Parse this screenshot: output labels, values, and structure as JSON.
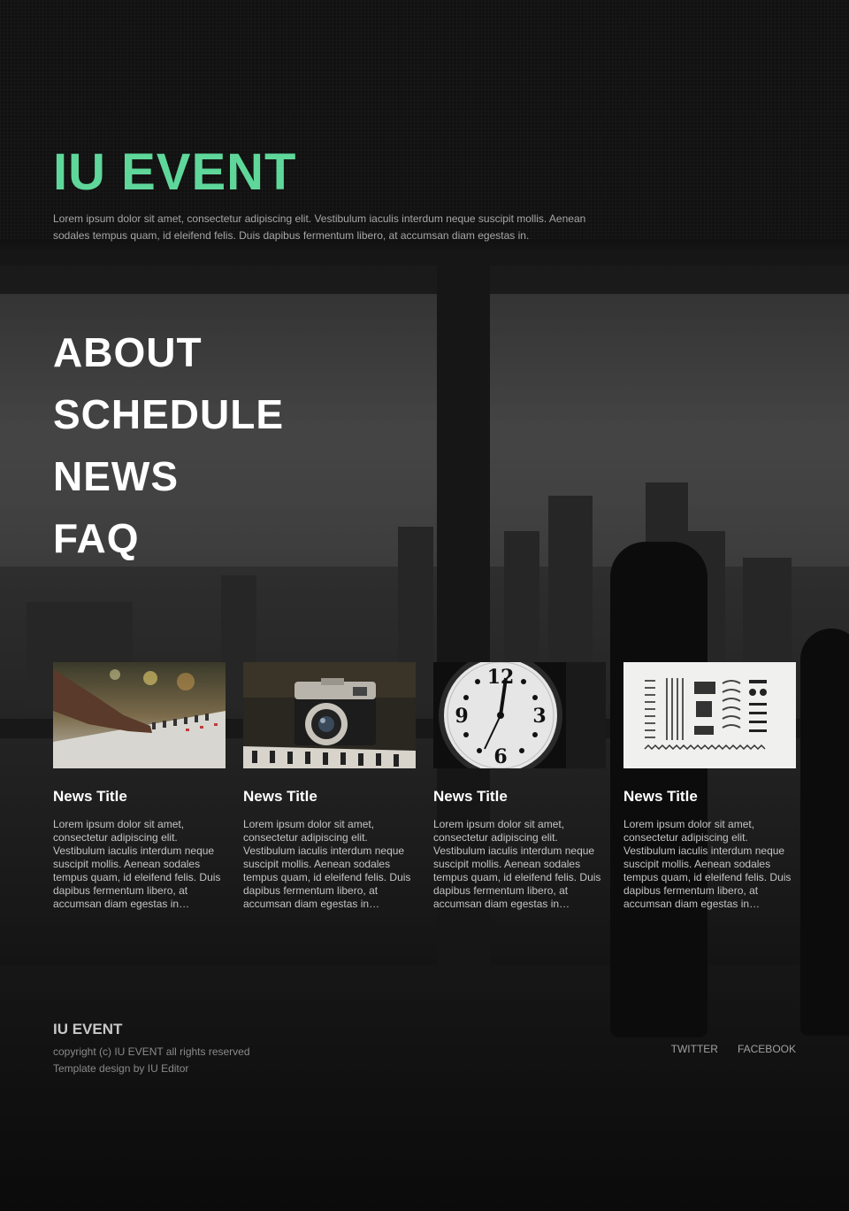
{
  "header": {
    "brand": "IU EVENT",
    "intro": "Lorem ipsum dolor sit amet, consectetur adipiscing elit. Vestibulum iaculis interdum neque suscipit mollis. Aenean sodales tempus quam, id eleifend felis. Duis dapibus fermentum libero, at accumsan diam egestas in."
  },
  "nav": {
    "items": [
      {
        "label": "ABOUT"
      },
      {
        "label": "SCHEDULE"
      },
      {
        "label": "NEWS"
      },
      {
        "label": "FAQ"
      }
    ]
  },
  "news": {
    "items": [
      {
        "title": "News Title",
        "image": "audio-mixer-photo",
        "excerpt": "Lorem ipsum dolor sit amet, consectetur adipiscing elit. Vestibulum iaculis interdum neque suscipit mollis. Aenean sodales tempus quam, id eleifend felis. Duis dapibus fermentum libero, at accumsan diam egestas in…"
      },
      {
        "title": "News Title",
        "image": "vintage-camera-photo",
        "excerpt": "Lorem ipsum dolor sit amet, consectetur adipiscing elit. Vestibulum iaculis interdum neque suscipit mollis. Aenean sodales tempus quam, id eleifend felis. Duis dapibus fermentum libero, at accumsan diam egestas in…"
      },
      {
        "title": "News Title",
        "image": "wall-clock-photo",
        "excerpt": "Lorem ipsum dolor sit amet, consectetur adipiscing elit. Vestibulum iaculis interdum neque suscipit mollis. Aenean sodales tempus quam, id eleifend felis. Duis dapibus fermentum libero, at accumsan diam egestas in…"
      },
      {
        "title": "News Title",
        "image": "typewriter-parts-photo",
        "excerpt": "Lorem ipsum dolor sit amet, consectetur adipiscing elit. Vestibulum iaculis interdum neque suscipit mollis. Aenean sodales tempus quam, id eleifend felis. Duis dapibus fermentum libero, at accumsan diam egestas in…"
      }
    ]
  },
  "footer": {
    "brand": "IU EVENT",
    "copyright": "copyright (c) IU EVENT all rights reserved",
    "credit": "Template design by IU Editor",
    "social": [
      {
        "label": "TWITTER"
      },
      {
        "label": "FACEBOOK"
      }
    ]
  },
  "colors": {
    "accent": "#5fd79a",
    "text": "#ffffff",
    "muted": "#a6a6a6",
    "background": "#141414"
  }
}
